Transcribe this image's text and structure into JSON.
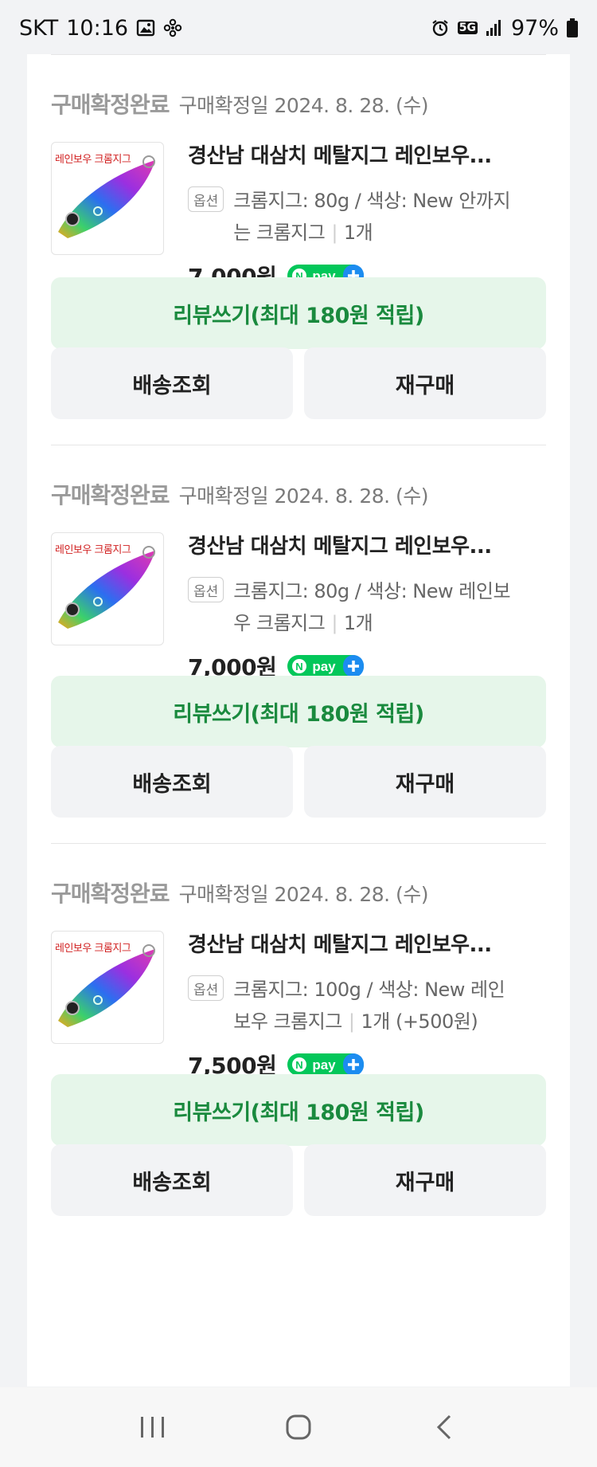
{
  "status_bar": {
    "carrier": "SKT",
    "time": "10:16",
    "network": "5G",
    "battery": "97%"
  },
  "orders": [
    {
      "status": "구매확정완료",
      "date": "구매확정일 2024. 8. 28. (수)",
      "thumb_text": "레인보우 크롬지그",
      "title": "경산남 대삼치 메탈지그 레인보우...",
      "option_badge": "옵션",
      "option_line1": "크롬지그: 80g / 색상: New 안까지",
      "option_line2": "는 크롬지그",
      "quantity": "1개",
      "price": "7,000원",
      "review_button": "리뷰쓰기(최대 180원 적립)",
      "delivery_button": "배송조회",
      "rebuy_button": "재구매"
    },
    {
      "status": "구매확정완료",
      "date": "구매확정일 2024. 8. 28. (수)",
      "thumb_text": "레인보우 크롬지그",
      "title": "경산남 대삼치 메탈지그 레인보우...",
      "option_badge": "옵션",
      "option_line1": "크롬지그: 80g / 색상: New 레인보",
      "option_line2": "우 크롬지그",
      "quantity": "1개",
      "price": "7,000원",
      "review_button": "리뷰쓰기(최대 180원 적립)",
      "delivery_button": "배송조회",
      "rebuy_button": "재구매"
    },
    {
      "status": "구매확정완료",
      "date": "구매확정일 2024. 8. 28. (수)",
      "thumb_text": "레인보우 크롬지그",
      "title": "경산남 대삼치 메탈지그 레인보우...",
      "option_badge": "옵션",
      "option_line1": "크롬지그: 100g / 색상: New 레인",
      "option_line2": "보우 크롬지그",
      "quantity": "1개 (+500원)",
      "price": "7,500원",
      "review_button": "리뷰쓰기(최대 180원 적립)",
      "delivery_button": "배송조회",
      "rebuy_button": "재구매"
    }
  ],
  "npay_label": "pay",
  "colors": {
    "review_bg": "#e6f6ea",
    "review_text": "#1a8a3e",
    "npay_green": "#03c75a",
    "npay_blue": "#1c8cf0"
  },
  "icons": [
    "gallery-icon",
    "flower-icon",
    "alarm-icon",
    "signal-icon",
    "battery-icon",
    "recents-icon",
    "home-icon",
    "back-icon"
  ]
}
